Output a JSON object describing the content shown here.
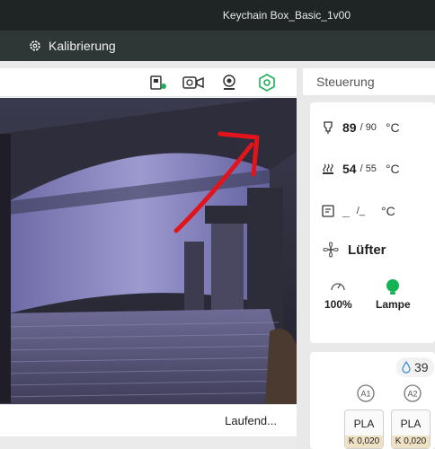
{
  "window": {
    "title": "Keychain Box_Basic_1v00"
  },
  "menu": {
    "tab_label": "Kalibrierung",
    "tab_icon": "gear-icon"
  },
  "toolbar": {
    "icons": [
      "printer-status-icon",
      "camera-video-icon",
      "webcam-icon",
      "settings-hex-icon"
    ],
    "active_color": "#1fae5b"
  },
  "status": {
    "text": "Laufend..."
  },
  "control": {
    "title": "Steuerung",
    "nozzle": {
      "current": "89",
      "target": "/ 90",
      "unit": "°C"
    },
    "bed": {
      "current": "54",
      "target": "/ 55",
      "unit": "°C"
    },
    "chamber": {
      "current": "_",
      "target": "/_",
      "unit": "°C"
    },
    "fan_label": "Lüfter",
    "speed_value": "100%",
    "lamp_label": "Lampe",
    "lamp_color": "#16b355"
  },
  "ams": {
    "humidity_value": "39",
    "slots": [
      "A1",
      "A2"
    ],
    "filaments": [
      {
        "name": "PLA",
        "k": "K 0,020"
      },
      {
        "name": "PLA",
        "k": "K 0,020"
      }
    ]
  },
  "annotation": {
    "arrow_color": "#e1141c"
  }
}
